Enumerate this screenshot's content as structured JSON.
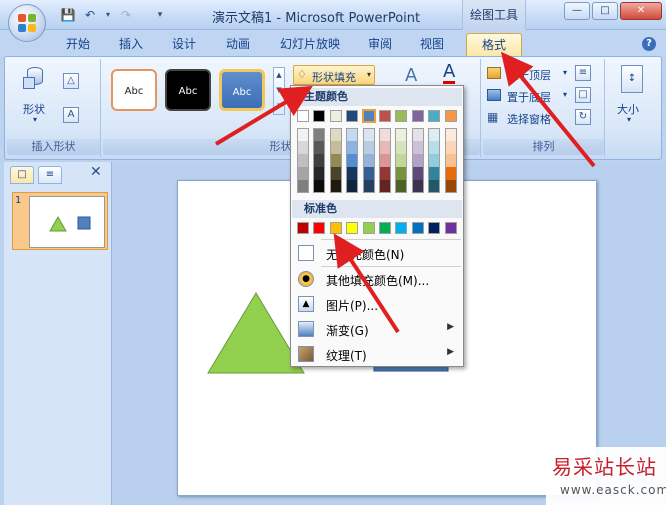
{
  "titlebar": {
    "document_title": "演示文稿1 - Microsoft PowerPoint",
    "contextual_tab_title": "绘图工具",
    "window_controls": [
      "—",
      "□",
      "✕"
    ]
  },
  "tabs": [
    {
      "label": "开始"
    },
    {
      "label": "插入"
    },
    {
      "label": "设计"
    },
    {
      "label": "动画"
    },
    {
      "label": "幻灯片放映"
    },
    {
      "label": "审阅"
    },
    {
      "label": "视图"
    },
    {
      "label": "格式",
      "active": true
    }
  ],
  "ribbon": {
    "insert_shapes": {
      "shapes_label": "形状",
      "group_label": "插入形状"
    },
    "shape_styles": {
      "thumbs": [
        "Abc",
        "Abc",
        "Abc"
      ],
      "fill_button_label": "形状填充",
      "group_label": "形状样式"
    },
    "arrange": {
      "bring_front_label": "置于顶层",
      "send_back_label": "置于底层",
      "selection_pane_label": "选择窗格",
      "group_label": "排列"
    },
    "size": {
      "size_label": "大小"
    }
  },
  "dropdown": {
    "theme_colors_header": "主题颜色",
    "standard_colors_header": "标准色",
    "theme_top_row": [
      "#ffffff",
      "#000000",
      "#eeece1",
      "#1f497d",
      "#4f81bd",
      "#c0504d",
      "#9bbb59",
      "#8064a2",
      "#4bacc6",
      "#f79646"
    ],
    "theme_shades": [
      [
        "#f2f2f2",
        "#7f7f7f",
        "#ddd9c3",
        "#c6d9f0",
        "#dbe5f1",
        "#f2dcdb",
        "#ebf1dd",
        "#e5e0ec",
        "#dbeef3",
        "#fdeada"
      ],
      [
        "#d8d8d8",
        "#595959",
        "#c4bd97",
        "#8db3e2",
        "#b8cce4",
        "#e5b9b7",
        "#d7e3bc",
        "#ccc1d9",
        "#b7dde8",
        "#fbd5b5"
      ],
      [
        "#bfbfbf",
        "#3f3f3f",
        "#938953",
        "#548dd4",
        "#95b3d7",
        "#d99694",
        "#c3d69b",
        "#b2a2c7",
        "#92cddc",
        "#fac08f"
      ],
      [
        "#a5a5a5",
        "#262626",
        "#494429",
        "#17365d",
        "#366092",
        "#953734",
        "#76923c",
        "#5f497a",
        "#31859b",
        "#e36c09"
      ],
      [
        "#7f7f7f",
        "#0c0c0c",
        "#1d1b10",
        "#0f243e",
        "#244061",
        "#632423",
        "#4f6128",
        "#3f3151",
        "#205867",
        "#974806"
      ]
    ],
    "standard_colors": [
      "#c00000",
      "#ff0000",
      "#ffc000",
      "#ffff00",
      "#92d050",
      "#00b050",
      "#00b0f0",
      "#0070c0",
      "#002060",
      "#7030a0"
    ],
    "items": [
      {
        "label": "无填充颜色(N)",
        "icon": "no-fill-icon",
        "submenu": false
      },
      {
        "label": "其他填充颜色(M)...",
        "icon": "palette-icon",
        "submenu": false
      },
      {
        "label": "图片(P)...",
        "icon": "picture-icon",
        "submenu": false
      },
      {
        "label": "渐变(G)",
        "icon": "gradient-icon",
        "submenu": true
      },
      {
        "label": "纹理(T)",
        "icon": "texture-icon",
        "submenu": true
      }
    ]
  },
  "slides_pane": {
    "slide_number": "1"
  },
  "slide": {
    "triangle_color": "#92d050",
    "square_color": "#4f81bd"
  },
  "watermark": {
    "brand": "易采站长站",
    "url": "www.easck.com"
  }
}
